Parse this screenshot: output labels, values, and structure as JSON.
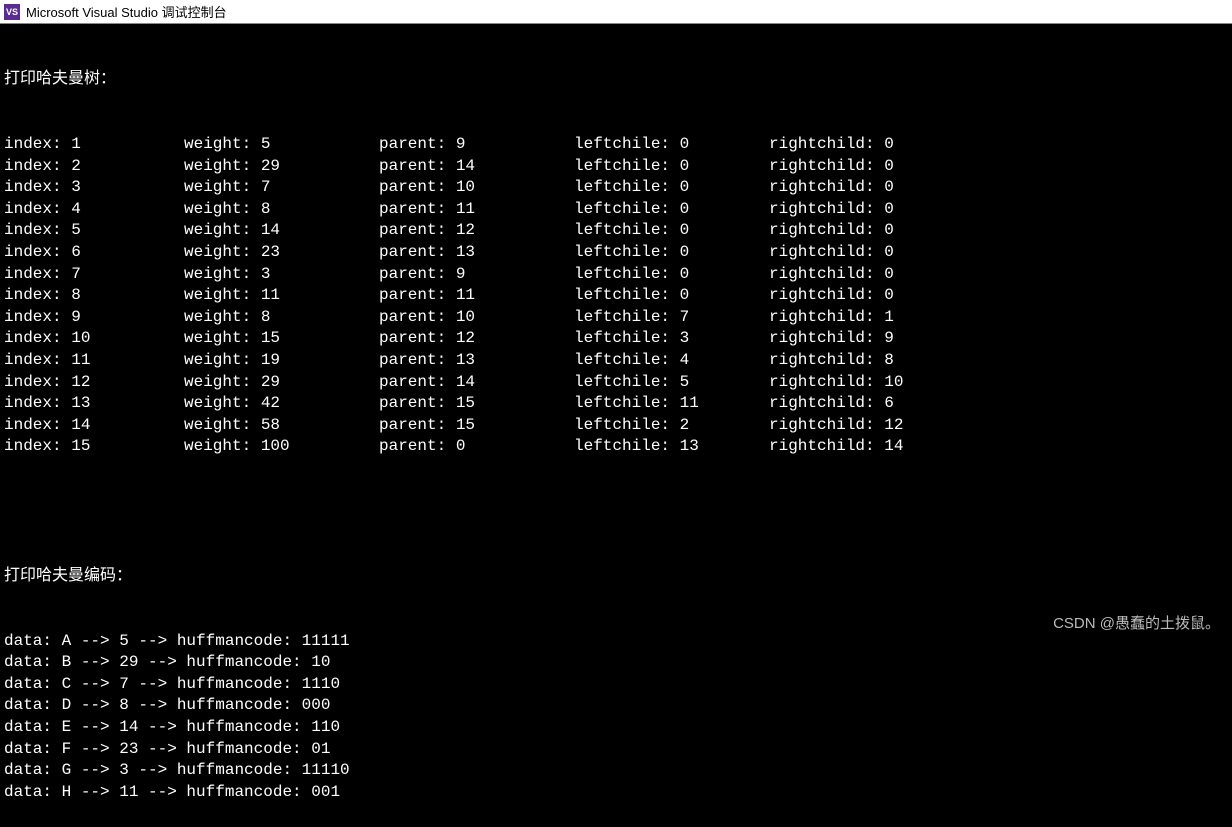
{
  "window": {
    "title": "Microsoft Visual Studio 调试控制台",
    "icon_text": "VS"
  },
  "console": {
    "tree_header": "打印哈夫曼树：",
    "labels": {
      "index": "index:",
      "weight": "weight:",
      "parent": "parent:",
      "leftchild": "leftchile:",
      "rightchild": "rightchild:"
    },
    "tree_rows": [
      {
        "index": "1",
        "weight": "5",
        "parent": "9",
        "leftchild": "0",
        "rightchild": "0"
      },
      {
        "index": "2",
        "weight": "29",
        "parent": "14",
        "leftchild": "0",
        "rightchild": "0"
      },
      {
        "index": "3",
        "weight": "7",
        "parent": "10",
        "leftchild": "0",
        "rightchild": "0"
      },
      {
        "index": "4",
        "weight": "8",
        "parent": "11",
        "leftchild": "0",
        "rightchild": "0"
      },
      {
        "index": "5",
        "weight": "14",
        "parent": "12",
        "leftchild": "0",
        "rightchild": "0"
      },
      {
        "index": "6",
        "weight": "23",
        "parent": "13",
        "leftchild": "0",
        "rightchild": "0"
      },
      {
        "index": "7",
        "weight": "3",
        "parent": "9",
        "leftchild": "0",
        "rightchild": "0"
      },
      {
        "index": "8",
        "weight": "11",
        "parent": "11",
        "leftchild": "0",
        "rightchild": "0"
      },
      {
        "index": "9",
        "weight": "8",
        "parent": "10",
        "leftchild": "7",
        "rightchild": "1"
      },
      {
        "index": "10",
        "weight": "15",
        "parent": "12",
        "leftchild": "3",
        "rightchild": "9"
      },
      {
        "index": "11",
        "weight": "19",
        "parent": "13",
        "leftchild": "4",
        "rightchild": "8"
      },
      {
        "index": "12",
        "weight": "29",
        "parent": "14",
        "leftchild": "5",
        "rightchild": "10"
      },
      {
        "index": "13",
        "weight": "42",
        "parent": "15",
        "leftchild": "11",
        "rightchild": "6"
      },
      {
        "index": "14",
        "weight": "58",
        "parent": "15",
        "leftchild": "2",
        "rightchild": "12"
      },
      {
        "index": "15",
        "weight": "100",
        "parent": "0",
        "leftchild": "13",
        "rightchild": "14"
      }
    ],
    "code_header": "打印哈夫曼编码：",
    "code_labels": {
      "data_prefix": "data:",
      "arrow": "-->",
      "huffman_prefix": "huffmancode:"
    },
    "code_rows": [
      {
        "data": "A",
        "weight": "5",
        "code": "11111"
      },
      {
        "data": "B",
        "weight": "29",
        "code": "10"
      },
      {
        "data": "C",
        "weight": "7",
        "code": "1110"
      },
      {
        "data": "D",
        "weight": "8",
        "code": "000"
      },
      {
        "data": "E",
        "weight": "14",
        "code": "110"
      },
      {
        "data": "F",
        "weight": "23",
        "code": "01"
      },
      {
        "data": "G",
        "weight": "3",
        "code": "11110"
      },
      {
        "data": "H",
        "weight": "11",
        "code": "001"
      }
    ]
  },
  "watermark": "CSDN @愚蠢的土拨鼠。"
}
